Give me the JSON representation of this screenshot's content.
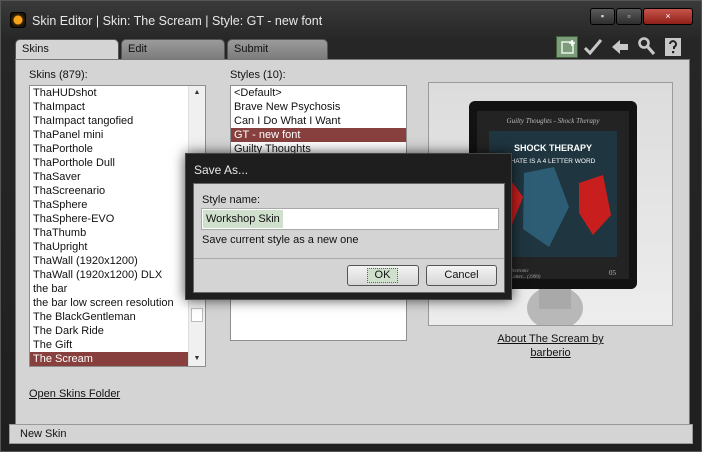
{
  "window": {
    "title": "Skin Editor | Skin: The Scream | Style: GT - new font"
  },
  "window_buttons": {
    "minimize": "▪",
    "maximize": "▫",
    "close": "×"
  },
  "tabs": [
    {
      "label": "Skins",
      "active": true
    },
    {
      "label": "Edit",
      "active": false
    },
    {
      "label": "Submit",
      "active": false
    }
  ],
  "toolbar_icons": [
    "new-skin-icon",
    "checkmark-icon",
    "back-arrow-icon",
    "wrench-icon",
    "help-icon"
  ],
  "skins": {
    "label": "Skins (879):",
    "items": [
      "ThaHUDshot",
      "ThaImpact",
      "ThaImpact tangofied",
      "ThaPanel mini",
      "ThaPorthole",
      "ThaPorthole Dull",
      "ThaSaver",
      "ThaScreenario",
      "ThaSphere",
      "ThaSphere-EVO",
      "ThaThumb",
      "ThaUpright",
      "ThaWall (1920x1200)",
      "ThaWall (1920x1200) DLX",
      "the bar",
      "the bar low screen resolution",
      "The BlackGentleman",
      "The Dark Ride",
      "The Gift",
      "The Scream"
    ],
    "selected": "The Scream"
  },
  "styles": {
    "label": "Styles (10):",
    "items": [
      "<Default>",
      "Brave New Psychosis",
      "Can I Do What I Want",
      "GT - new font",
      "Guilty Thoughts"
    ],
    "selected": "GT - new font"
  },
  "preview": {
    "cd_text": "Guilty Thoughts - Shock Therapy",
    "album_title": "SHOCK THERAPY",
    "album_subtitle": "HATE IS A 4 LETTER WORD",
    "bottom_left": "GT Rhys | Electronic",
    "bottom_left2": "Hate Is A 4 Letter... (1999)",
    "bottom_right": "05"
  },
  "about": {
    "line1": "About The Scream by",
    "line2": "barberio"
  },
  "open_folder_link": "Open Skins Folder",
  "status": "New Skin",
  "dialog": {
    "title": "Save As...",
    "field_label": "Style name:",
    "input_value": "Workshop Skin",
    "hint": "Save current style as a new one",
    "ok": "OK",
    "cancel": "Cancel"
  },
  "colors": {
    "selection": "#87403d",
    "accent_green": "#cfe0cd",
    "close_red": "#b3392f"
  }
}
